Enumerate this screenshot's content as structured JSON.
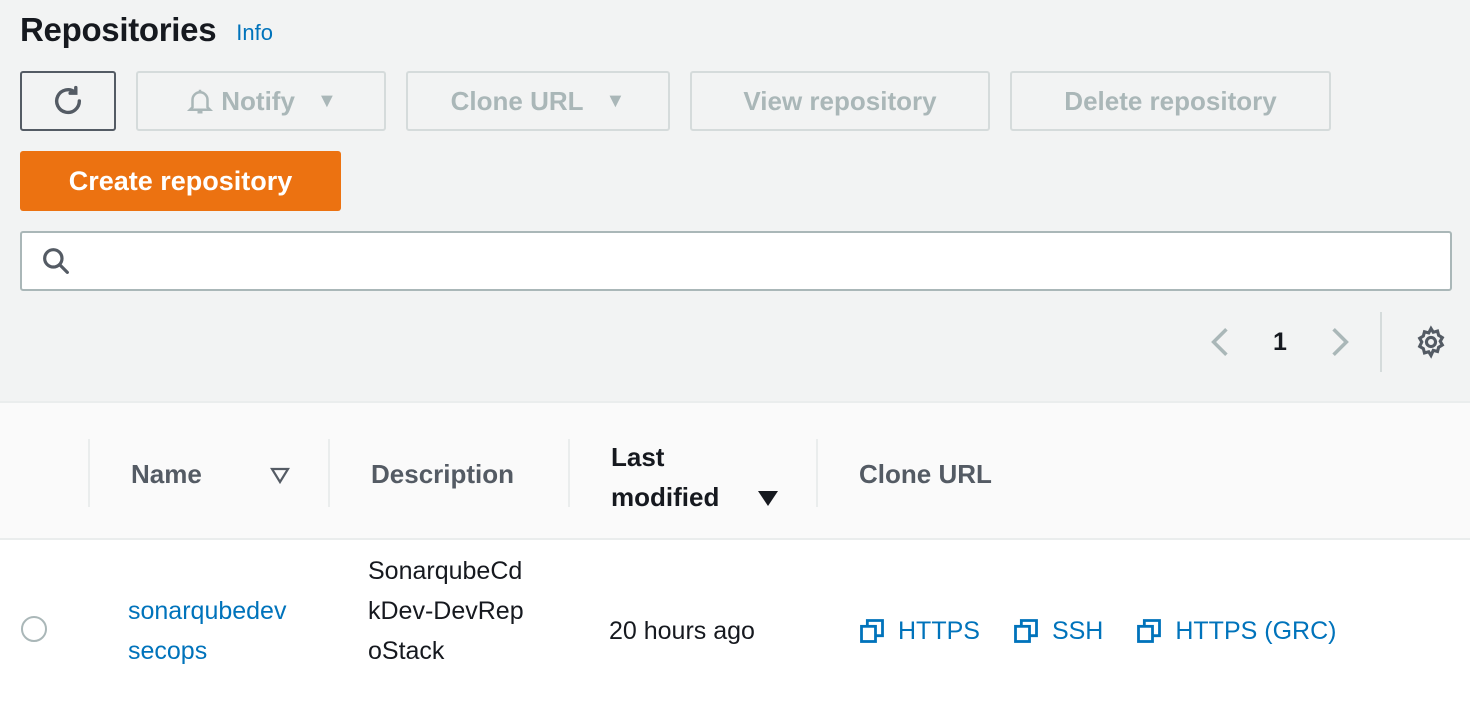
{
  "header": {
    "title": "Repositories",
    "info_label": "Info"
  },
  "toolbar": {
    "refresh_icon": "refresh-icon",
    "notify_label": "Notify",
    "clone_url_label": "Clone URL",
    "view_label": "View repository",
    "delete_label": "Delete repository",
    "create_label": "Create repository"
  },
  "search": {
    "value": "",
    "placeholder": ""
  },
  "pagination": {
    "current_page": "1"
  },
  "table": {
    "columns": [
      "Name",
      "Description",
      "Last modified",
      "Clone URL"
    ],
    "column_mod_line1": "Last",
    "column_mod_line2": "modified",
    "rows": [
      {
        "name": "sonarqubedevsecops",
        "description": "SonarqubeCdkDev-DevRepoStack",
        "last_modified": "20 hours ago",
        "clone_links": [
          "HTTPS",
          "SSH",
          "HTTPS (GRC)"
        ]
      }
    ]
  },
  "colors": {
    "accent": "#ec7211",
    "link": "#0073bb",
    "disabled": "#aab7b8",
    "background": "#f2f3f3"
  }
}
